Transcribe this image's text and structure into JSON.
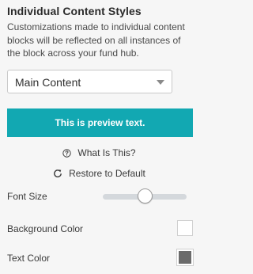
{
  "panel": {
    "title": "Individual Content Styles",
    "description": "Customizations made to individual content blocks will be reflected on all instances of the block across your fund hub."
  },
  "dropdown": {
    "selected": "Main Content",
    "icon": "chevron-down-icon"
  },
  "preview": {
    "text": "This is preview text.",
    "background_color": "#12a8b2",
    "text_color": "#ffffff"
  },
  "links": {
    "what_is_this": "What Is This?",
    "what_is_this_icon": "question-circle-icon",
    "restore_default": "Restore to Default",
    "restore_icon": "refresh-icon"
  },
  "settings": {
    "font_size_label": "Font Size",
    "font_size_level": 0.5,
    "background_color_label": "Background Color",
    "background_color_value": "#ffffff",
    "text_color_label": "Text Color",
    "text_color_value": "#6b6b6b"
  }
}
